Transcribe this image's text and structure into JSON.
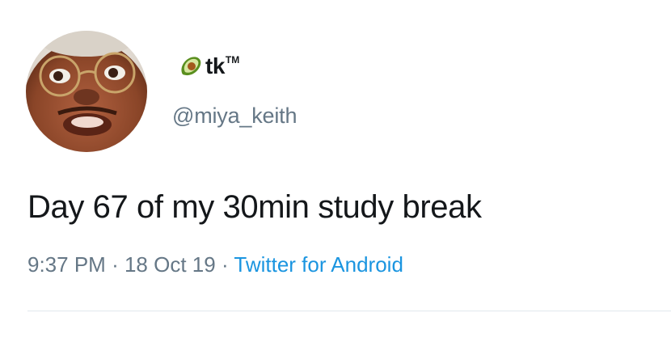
{
  "tweet": {
    "author": {
      "display_name": "tk",
      "trademark": "TM",
      "display_name_emoji": "avocado-icon",
      "handle": "@miya_keith",
      "avatar": "avatar-photo"
    },
    "text": "Day 67 of my 30min study break",
    "time": "9:37 PM",
    "separator": "·",
    "date": "18 Oct 19",
    "source": "Twitter for Android"
  },
  "colors": {
    "text": "#14171a",
    "secondary": "#657786",
    "link": "#1b95e0",
    "divider": "#e1e8ed"
  }
}
